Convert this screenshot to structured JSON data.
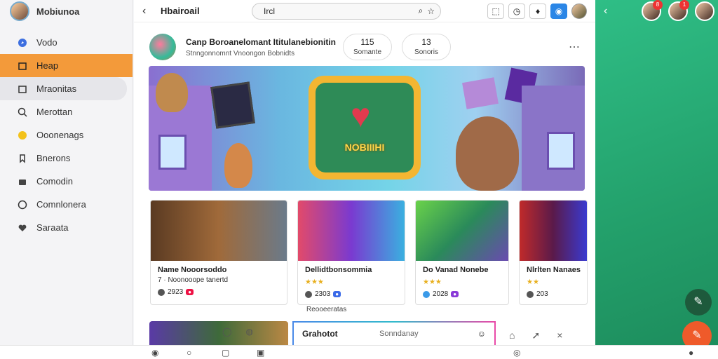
{
  "brand": {
    "name": "Mobiunoa"
  },
  "sidebar": {
    "items": [
      {
        "label": "Vodo",
        "icon": "compass-icon"
      },
      {
        "label": "Heap",
        "icon": "home-icon"
      },
      {
        "label": "Mraonitas",
        "icon": "image-icon"
      },
      {
        "label": "Merottan",
        "icon": "search-icon"
      },
      {
        "label": "Ooonenags",
        "icon": "smile-icon"
      },
      {
        "label": "Bnerons",
        "icon": "bookmark-icon"
      },
      {
        "label": "Comodin",
        "icon": "folder-icon"
      },
      {
        "label": "Comnlonera",
        "icon": "chat-icon"
      },
      {
        "label": "Saraata",
        "icon": "heart-icon"
      }
    ]
  },
  "topbar": {
    "title": "Hbairoail",
    "search_value": "Ircl"
  },
  "group": {
    "name": "Canp Boroanelomant Ititulanebionitin",
    "subtitle": "Stnngonnomnt Vnoongon Bobnidts",
    "stats": [
      {
        "value": "115",
        "label": "Somante"
      },
      {
        "value": "13",
        "label": "Sonoris"
      }
    ]
  },
  "banner": {
    "tv_label": "NOBIIIHI"
  },
  "cards": [
    {
      "title": "Name Nooorsoddo",
      "subtitle": "7 · Noonooope tanertd",
      "meta": "2923"
    },
    {
      "title": "Dellidtbonsommia",
      "subtitle": "",
      "meta": "2303"
    },
    {
      "title": "Do Vanad Nonebe",
      "subtitle": "",
      "meta": "2028"
    },
    {
      "title": "Nlrlten Nanaes",
      "subtitle": "",
      "meta": "203"
    }
  ],
  "below_label": "Reooeeratas",
  "chat": {
    "title": "Grahotot",
    "placeholder": "Sonndanay"
  },
  "colors": {
    "accent": "#f39a3a",
    "brand_green": "#2fbe86",
    "fab_orange": "#ef5a2a"
  },
  "right_panel": {
    "badges": [
      "8",
      "1"
    ]
  }
}
